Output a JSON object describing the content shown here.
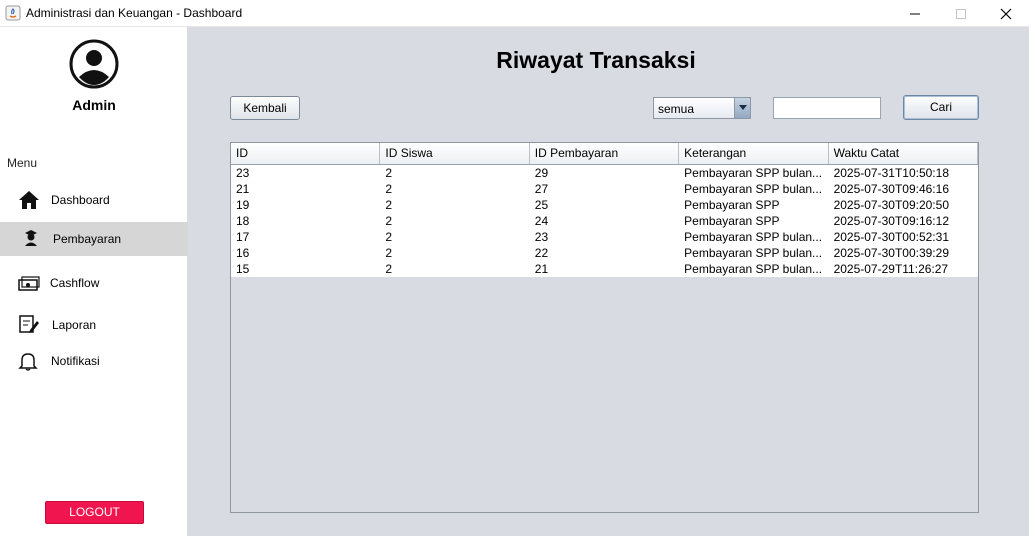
{
  "window": {
    "title": "Administrasi dan Keuangan - Dashboard"
  },
  "sidebar": {
    "user_name": "Admin",
    "menu_label": "Menu",
    "items": [
      {
        "label": "Dashboard",
        "icon": "home-icon",
        "active": false
      },
      {
        "label": "Pembayaran",
        "icon": "student-icon",
        "active": true
      },
      {
        "label": "Cashflow",
        "icon": "cash-icon",
        "active": false
      },
      {
        "label": "Laporan",
        "icon": "report-edit-icon",
        "active": false
      },
      {
        "label": "Notifikasi",
        "icon": "bell-icon",
        "active": false
      }
    ],
    "logout_label": "LOGOUT",
    "logout_color": "#f0144f"
  },
  "main": {
    "title": "Riwayat Transaksi",
    "back_label": "Kembali",
    "filter": {
      "selected": "semua"
    },
    "search": {
      "value": "",
      "placeholder": ""
    },
    "search_label": "Cari",
    "table": {
      "columns": [
        "ID",
        "ID Siswa",
        "ID Pembayaran",
        "Keterangan",
        "Waktu Catat"
      ],
      "rows": [
        [
          "23",
          "2",
          "29",
          "Pembayaran SPP bulan...",
          "2025-07-31T10:50:18"
        ],
        [
          "21",
          "2",
          "27",
          "Pembayaran SPP bulan...",
          "2025-07-30T09:46:16"
        ],
        [
          "19",
          "2",
          "25",
          "Pembayaran SPP",
          "2025-07-30T09:20:50"
        ],
        [
          "18",
          "2",
          "24",
          "Pembayaran SPP",
          "2025-07-30T09:16:12"
        ],
        [
          "17",
          "2",
          "23",
          "Pembayaran SPP bulan...",
          "2025-07-30T00:52:31"
        ],
        [
          "16",
          "2",
          "22",
          "Pembayaran SPP bulan...",
          "2025-07-30T00:39:29"
        ],
        [
          "15",
          "2",
          "21",
          "Pembayaran SPP bulan...",
          "2025-07-29T11:26:27"
        ]
      ]
    }
  }
}
